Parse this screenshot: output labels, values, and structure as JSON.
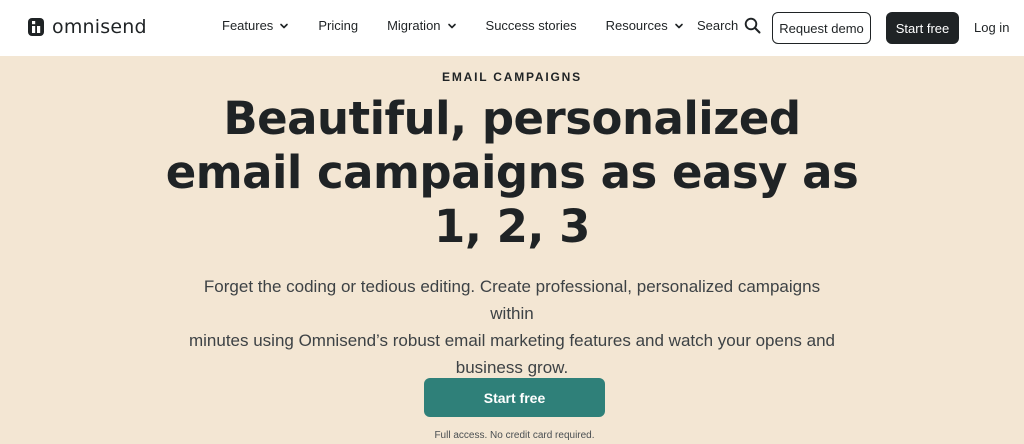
{
  "header": {
    "logo_text": "omnisend",
    "logo_icon": "omnisend-logo-icon",
    "menu": [
      {
        "label": "Features",
        "has_dropdown": true
      },
      {
        "label": "Pricing",
        "has_dropdown": false
      },
      {
        "label": "Migration",
        "has_dropdown": true
      },
      {
        "label": "Success stories",
        "has_dropdown": false
      },
      {
        "label": "Resources",
        "has_dropdown": true
      }
    ],
    "search_label": "Search",
    "request_demo_label": "Request demo",
    "start_free_label": "Start free",
    "login_label": "Log in"
  },
  "hero": {
    "eyebrow": "EMAIL CAMPAIGNS",
    "headline_line1": "Beautiful, personalized",
    "headline_line2": "email campaigns as easy as",
    "headline_line3": "1, 2, 3",
    "subtitle_line1": "Forget the coding or tedious editing. Create professional, personalized campaigns within",
    "subtitle_line2": "minutes using Omnisend’s robust email marketing features and watch your opens and",
    "subtitle_line3": "business grow.",
    "cta_label": "Start free",
    "note": "Full access. No credit card required."
  },
  "colors": {
    "background": "#f3e6d3",
    "header": "#ffffff",
    "text": "#1f2325",
    "cta": "#2f8079",
    "dark_button": "#1f2325"
  }
}
